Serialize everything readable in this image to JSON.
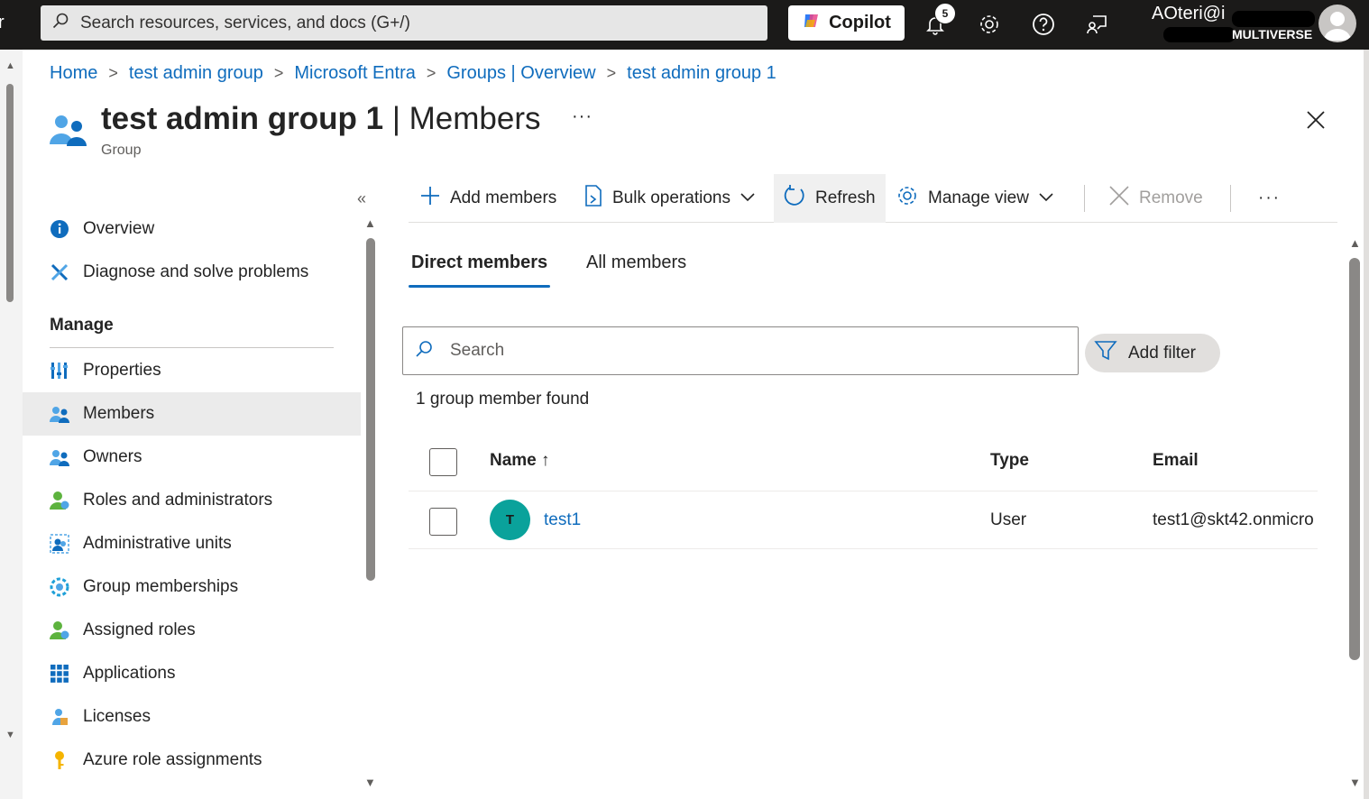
{
  "topbar": {
    "edge_char": "r",
    "search_placeholder": "Search resources, services, and docs (G+/)",
    "copilot_label": "Copilot",
    "notification_count": "5",
    "user_name": "AOteri@i",
    "tenant": "MULTIVERSE",
    "icons": [
      "bell-icon",
      "gear-icon",
      "help-icon",
      "feedback-icon"
    ]
  },
  "breadcrumb": [
    "Home",
    "test admin group",
    "Microsoft Entra",
    "Groups | Overview",
    "test admin group 1"
  ],
  "header": {
    "title_bold": "test admin group 1",
    "title_rest": " | Members",
    "subtitle": "Group",
    "more": "···"
  },
  "nav": {
    "collapse": "«",
    "top_items": [
      {
        "label": "Overview",
        "icon": "info-icon"
      },
      {
        "label": "Diagnose and solve problems",
        "icon": "wrench-icon"
      }
    ],
    "section_label": "Manage",
    "manage_items": [
      {
        "label": "Properties",
        "icon": "properties-icon"
      },
      {
        "label": "Members",
        "icon": "members-icon",
        "active": true
      },
      {
        "label": "Owners",
        "icon": "owners-icon"
      },
      {
        "label": "Roles and administrators",
        "icon": "roles-icon"
      },
      {
        "label": "Administrative units",
        "icon": "admin-units-icon"
      },
      {
        "label": "Group memberships",
        "icon": "group-memberships-icon"
      },
      {
        "label": "Assigned roles",
        "icon": "assigned-roles-icon"
      },
      {
        "label": "Applications",
        "icon": "applications-icon"
      },
      {
        "label": "Licenses",
        "icon": "licenses-icon"
      },
      {
        "label": "Azure role assignments",
        "icon": "key-icon"
      }
    ]
  },
  "toolbar": {
    "add_members": "Add members",
    "bulk_operations": "Bulk operations",
    "refresh": "Refresh",
    "manage_view": "Manage view",
    "remove": "Remove",
    "more": "···"
  },
  "tabs": [
    {
      "label": "Direct members",
      "active": true
    },
    {
      "label": "All members",
      "active": false
    }
  ],
  "member_search": {
    "placeholder": "Search",
    "value": ""
  },
  "filter_label": "Add filter",
  "results_text": "1 group member found",
  "table": {
    "columns": [
      "Name ↑",
      "Type",
      "Email"
    ],
    "rows": [
      {
        "initial": "T",
        "name": "test1",
        "type": "User",
        "email": "test1@skt42.onmicro"
      }
    ]
  },
  "colors": {
    "topbar_bg": "#1b1a19",
    "link": "#0f6cbd",
    "avatar_teal": "#0aa29b",
    "active_nav_bg": "#ebebeb"
  }
}
